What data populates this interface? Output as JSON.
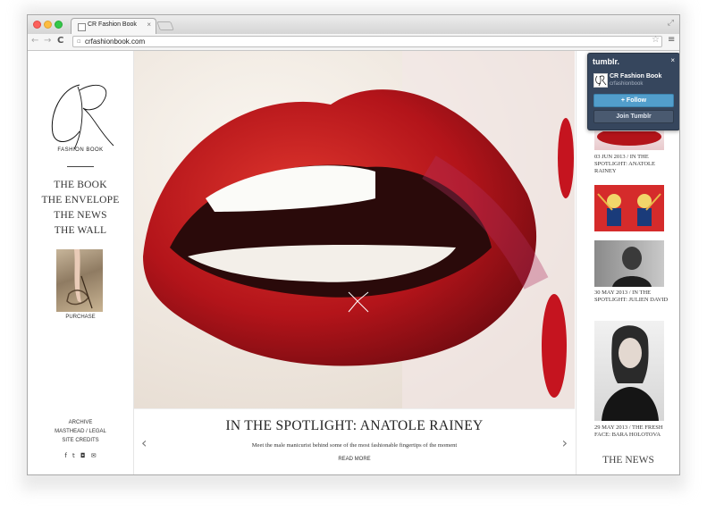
{
  "browser": {
    "tab_title": "CR Fashion Book",
    "tab_close": "×",
    "url": "crfashionbook.com",
    "star_icon": "☆",
    "menu_icon": "≡",
    "back_icon": "←",
    "forward_icon": "→",
    "reload_icon": "C",
    "fullscreen_icon": "⤢"
  },
  "sidebar": {
    "logo_text": "FASHION BOOK",
    "nav": [
      "THE BOOK",
      "THE ENVELOPE",
      "THE NEWS",
      "THE WALL"
    ],
    "purchase_label": "PURCHASE",
    "footer_links": [
      "ARCHIVE",
      "MASTHEAD / LEGAL",
      "SITE CREDITS"
    ],
    "social_icons": [
      "facebook-icon",
      "twitter-icon",
      "instagram-icon",
      "mail-icon"
    ],
    "social_glyphs": [
      "f",
      "t",
      "◘",
      "✉"
    ]
  },
  "feature": {
    "title": "IN THE SPOTLIGHT: ANATOLE RAINEY",
    "description": "Meet the male manicurist behind some of the most fashionable fingertips of the moment",
    "read_more": "READ MORE",
    "prev_icon": "‹",
    "next_icon": "›"
  },
  "news": {
    "posts": [
      {
        "caption": "03 JUN 2013 / IN THE SPOTLIGHT: ANATOLE RAINEY"
      },
      {
        "caption": ""
      },
      {
        "caption": "30 MAY 2013 / IN THE SPOTLIGHT: JULIEN DAVID"
      },
      {
        "caption": "29 MAY 2013 / THE FRESH FACE: BARA HOLOTOVA"
      }
    ],
    "section_title": "THE NEWS"
  },
  "tumblr_widget": {
    "logo": "tumblr.",
    "close": "×",
    "blog_name": "CR Fashion Book",
    "blog_handle": "crfashionbook",
    "follow_label": "+ Follow",
    "join_label": "Join Tumblr",
    "colors": {
      "bg": "#36465d",
      "follow": "#529ecc"
    }
  }
}
